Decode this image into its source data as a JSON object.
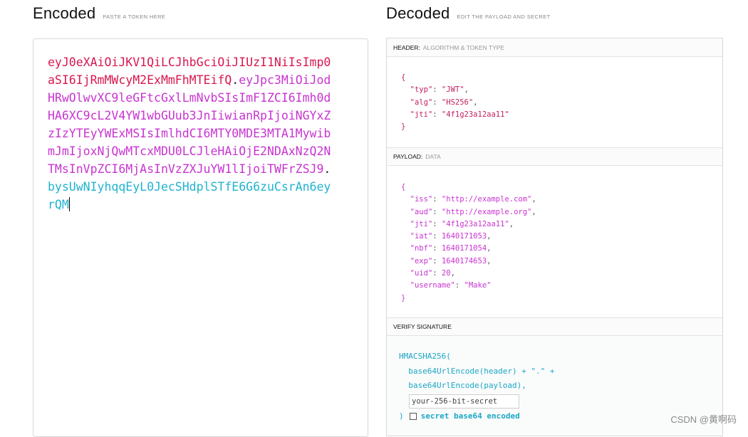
{
  "encoded": {
    "title": "Encoded",
    "subtitle": "PASTE A TOKEN HERE",
    "token_header": "eyJ0eXAiOiJKV1QiLCJhbGciOiJIUzI1NiIsImp0aSI6IjRmMWcyM2ExMmFhMTEifQ",
    "dot1": ".",
    "token_payload": "eyJpc3MiOiJodHRwOlwvXC9leGFtcGxlLmNvbSIsImF1ZCI6Imh0dHA6XC9cL2V4YW1wbGUub3JnIiwianRpIjoiNGYxZzIzYTEyYWExMSIsImlhdCI6MTY0MDE3MTA1MywibmJmIjoxNjQwMTcxMDU0LCJleHAiOjE2NDAxNzQ2NTMsInVpZCI6MjAsInVzZXJuYW1lIjoiTWFrZSJ9",
    "dot2": ".",
    "token_signature": "bysUwNIyhqqEyL0JecSHdplSTfE6G6zuCsrAn6eyrQM"
  },
  "decoded": {
    "title": "Decoded",
    "subtitle": "EDIT THE PAYLOAD AND SECRET",
    "header": {
      "label": "HEADER:",
      "desc": "ALGORITHM & TOKEN TYPE",
      "typ": "JWT",
      "alg": "HS256",
      "jti": "4f1g23a12aa11"
    },
    "payload": {
      "label": "PAYLOAD:",
      "desc": "DATA",
      "iss": "http://example.com",
      "aud": "http://example.org",
      "jti": "4f1g23a12aa11",
      "iat": "1640171053",
      "nbf": "1640171054",
      "exp": "1640174653",
      "uid": "20",
      "username": "Make"
    },
    "verify": {
      "label": "VERIFY SIGNATURE",
      "line1": "HMACSHA256(",
      "line2": "  base64UrlEncode(header) + \".\" +",
      "line3": "  base64UrlEncode(payload),",
      "secret_placeholder": "your-256-bit-secret",
      "close": ")",
      "checkbox_label": "secret base64 encoded"
    }
  },
  "watermark": "CSDN @黄啊码"
}
